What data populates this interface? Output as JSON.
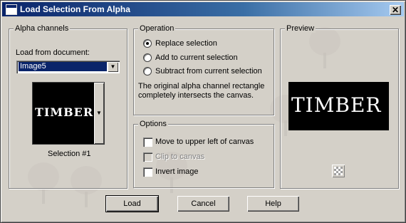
{
  "window": {
    "title": "Load Selection From Alpha",
    "close_glyph": "✕"
  },
  "alpha": {
    "group_title": "Alpha channels",
    "load_from_label": "Load from document:",
    "document_value": "Image5",
    "thumbnail_text": "TIMBER",
    "selection_label": "Selection #1"
  },
  "operation": {
    "group_title": "Operation",
    "options": [
      {
        "label": "Replace selection",
        "checked": true
      },
      {
        "label": "Add to current selection",
        "checked": false
      },
      {
        "label": "Subtract from current selection",
        "checked": false
      }
    ],
    "note_line1": "The original alpha channel rectangle",
    "note_line2": "completely intersects the canvas."
  },
  "options": {
    "group_title": "Options",
    "items": [
      {
        "label": "Move to upper left of canvas",
        "checked": false,
        "enabled": true
      },
      {
        "label": "Clip to canvas",
        "checked": false,
        "enabled": false
      },
      {
        "label": "Invert image",
        "checked": false,
        "enabled": true
      }
    ]
  },
  "preview": {
    "group_title": "Preview",
    "preview_text": "TIMBER"
  },
  "buttons": {
    "load": "Load",
    "cancel": "Cancel",
    "help": "Help"
  }
}
